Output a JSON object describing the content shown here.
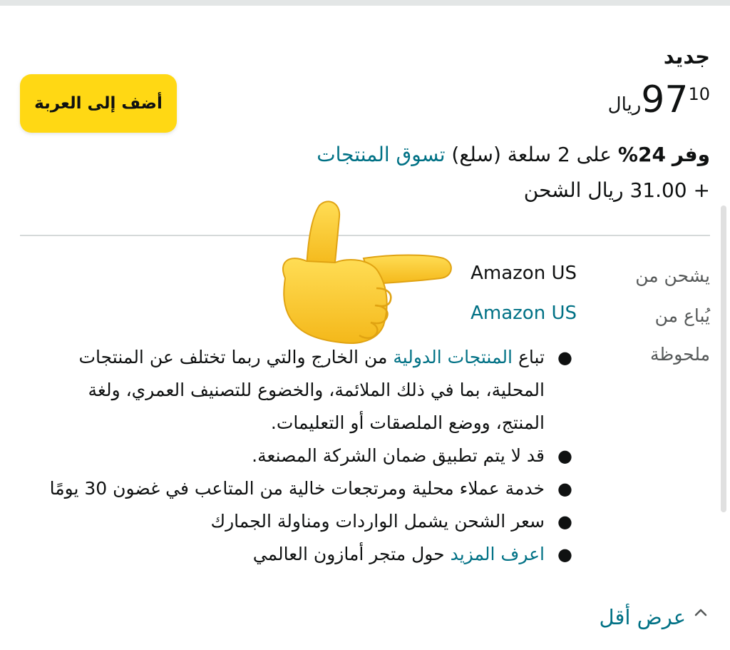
{
  "offer": {
    "condition": "جديد",
    "price": {
      "currency": "ريال",
      "whole": "97",
      "fraction": "10"
    },
    "add_to_cart_label": "أضف إلى العربة",
    "savings": {
      "prefix": "وفر",
      "percent": "24%",
      "middle": "على 2 سلعة (سلع)",
      "link_text": "تسوق المنتجات"
    },
    "shipping": "+ 31.00 ريال الشحن"
  },
  "details": {
    "ships_from_label": "يشحن من",
    "ships_from_value": "Amazon US",
    "sold_by_label": "يُباع من",
    "sold_by_value": "Amazon US",
    "note_label": "ملحوظة"
  },
  "notes": {
    "n1_pre": "تباع",
    "n1_link": "المنتجات الدولية",
    "n1_post": "من الخارج والتي ربما تختلف عن المنتجات المحلية، بما في ذلك الملائمة، والخضوع للتصنيف العمري، ولغة المنتج، ووضع الملصقات أو التعليمات.",
    "n2": "قد لا يتم تطبيق ضمان الشركة المصنعة.",
    "n3": "خدمة عملاء محلية ومرتجعات خالية من المتاعب في غضون 30 يومًا",
    "n4": "سعر الشحن يشمل الواردات ومناولة الجمارك",
    "n5_link": "اعرف المزيد",
    "n5_post": "حول متجر أمازون العالمي"
  },
  "show_less_label": "عرض أقل",
  "overlay": {
    "icon": "pointing-hand-emoji",
    "skin_color": "#f9c91e"
  }
}
